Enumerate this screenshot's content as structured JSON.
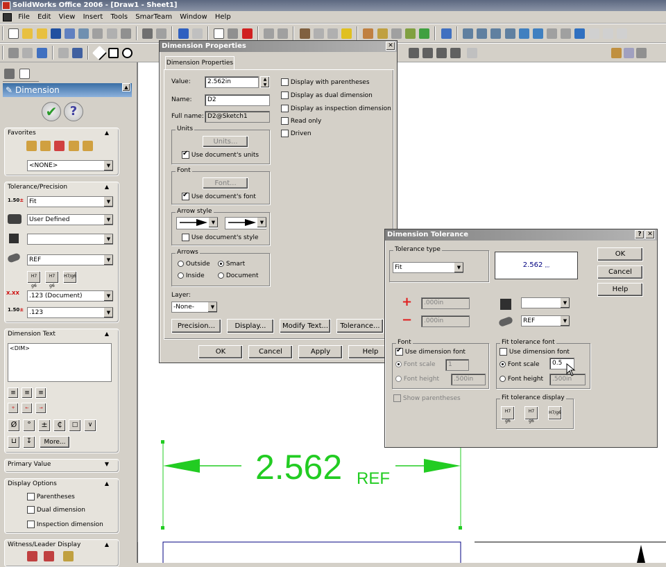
{
  "window": {
    "title": "SolidWorks Office 2006 - [Draw1 - Sheet1]"
  },
  "menu": [
    "File",
    "Edit",
    "View",
    "Insert",
    "Tools",
    "SmarTeam",
    "Window",
    "Help"
  ],
  "panel": {
    "header": "Dimension",
    "favorites": {
      "title": "Favorites",
      "value": "<NONE>"
    },
    "tolerance": {
      "title": "Tolerance/Precision",
      "type": "Fit",
      "fit_class": "User Defined",
      "hole_fit": "",
      "shaft_fit": "REF",
      "fit_icons": [
        "H7/g6-stacked",
        "H7/g6",
        "H7/g6-diag"
      ],
      "precision": ".123 (Document)",
      "tol_precision": ".123",
      "prec_prefix_1": "1.50",
      "prec_prefix_2": "1.50"
    },
    "dim_text": {
      "title": "Dimension Text",
      "content": "<DIM>",
      "more": "More..."
    },
    "primary_value": {
      "title": "Primary Value"
    },
    "display_options": {
      "title": "Display Options",
      "items": [
        "Parentheses",
        "Dual dimension",
        "Inspection dimension"
      ]
    },
    "witness": {
      "title": "Witness/Leader Display"
    }
  },
  "dim_props": {
    "title": "Dimension Properties",
    "tab": "Dimension Properties",
    "value_label": "Value:",
    "value": "2.562in",
    "name_label": "Name:",
    "name": "D2",
    "fullname_label": "Full name:",
    "fullname": "D2@Sketch1",
    "checks": [
      "Display with parentheses",
      "Display as dual dimension",
      "Display as inspection dimension",
      "Read only",
      "Driven"
    ],
    "units_label": "Units",
    "units_btn": "Units...",
    "use_doc_units": "Use document's units",
    "font_label": "Font",
    "font_btn": "Font...",
    "use_doc_font": "Use document's font",
    "arrow_style_label": "Arrow style",
    "use_doc_style": "Use document's style",
    "arrows_label": "Arrows",
    "outside": "Outside",
    "smart": "Smart",
    "inside": "Inside",
    "document": "Document",
    "layer_label": "Layer:",
    "layer": "-None-",
    "btn_precision": "Precision...",
    "btn_display": "Display...",
    "btn_modify": "Modify Text...",
    "btn_tolerance": "Tolerance...",
    "ok": "OK",
    "cancel": "Cancel",
    "apply": "Apply",
    "help": "Help"
  },
  "dim_tol": {
    "title": "Dimension Tolerance",
    "tol_type_label": "Tolerance type",
    "tol_type": "Fit",
    "preview_value": "2.562",
    "preview_suffix": ",,,",
    "plus": "+",
    "minus": "−",
    "plus_val": ".000in",
    "minus_val": ".000in",
    "hole_fit": "",
    "shaft_fit": "REF",
    "font_label": "Font",
    "use_dim_font": "Use dimension font",
    "font_scale": "Font scale",
    "font_scale_val": "1",
    "font_height": "Font height",
    "font_height_val": ".500in",
    "fit_font_label": "Fit tolerance font",
    "fit_use_dim_font": "Use dimension font",
    "fit_font_scale": "Font scale",
    "fit_font_scale_val": "0.5",
    "fit_font_height": "Font height",
    "fit_font_height_val": ".500in",
    "show_paren": "Show parentheses",
    "fit_display_label": "Fit tolerance display",
    "ok": "OK",
    "cancel": "Cancel",
    "help": "Help"
  },
  "drawing": {
    "dimension": "2.562",
    "suffix": "REF"
  },
  "colors": {
    "dim_green": "#22cc22",
    "title_blue": "#3a6ea5"
  }
}
